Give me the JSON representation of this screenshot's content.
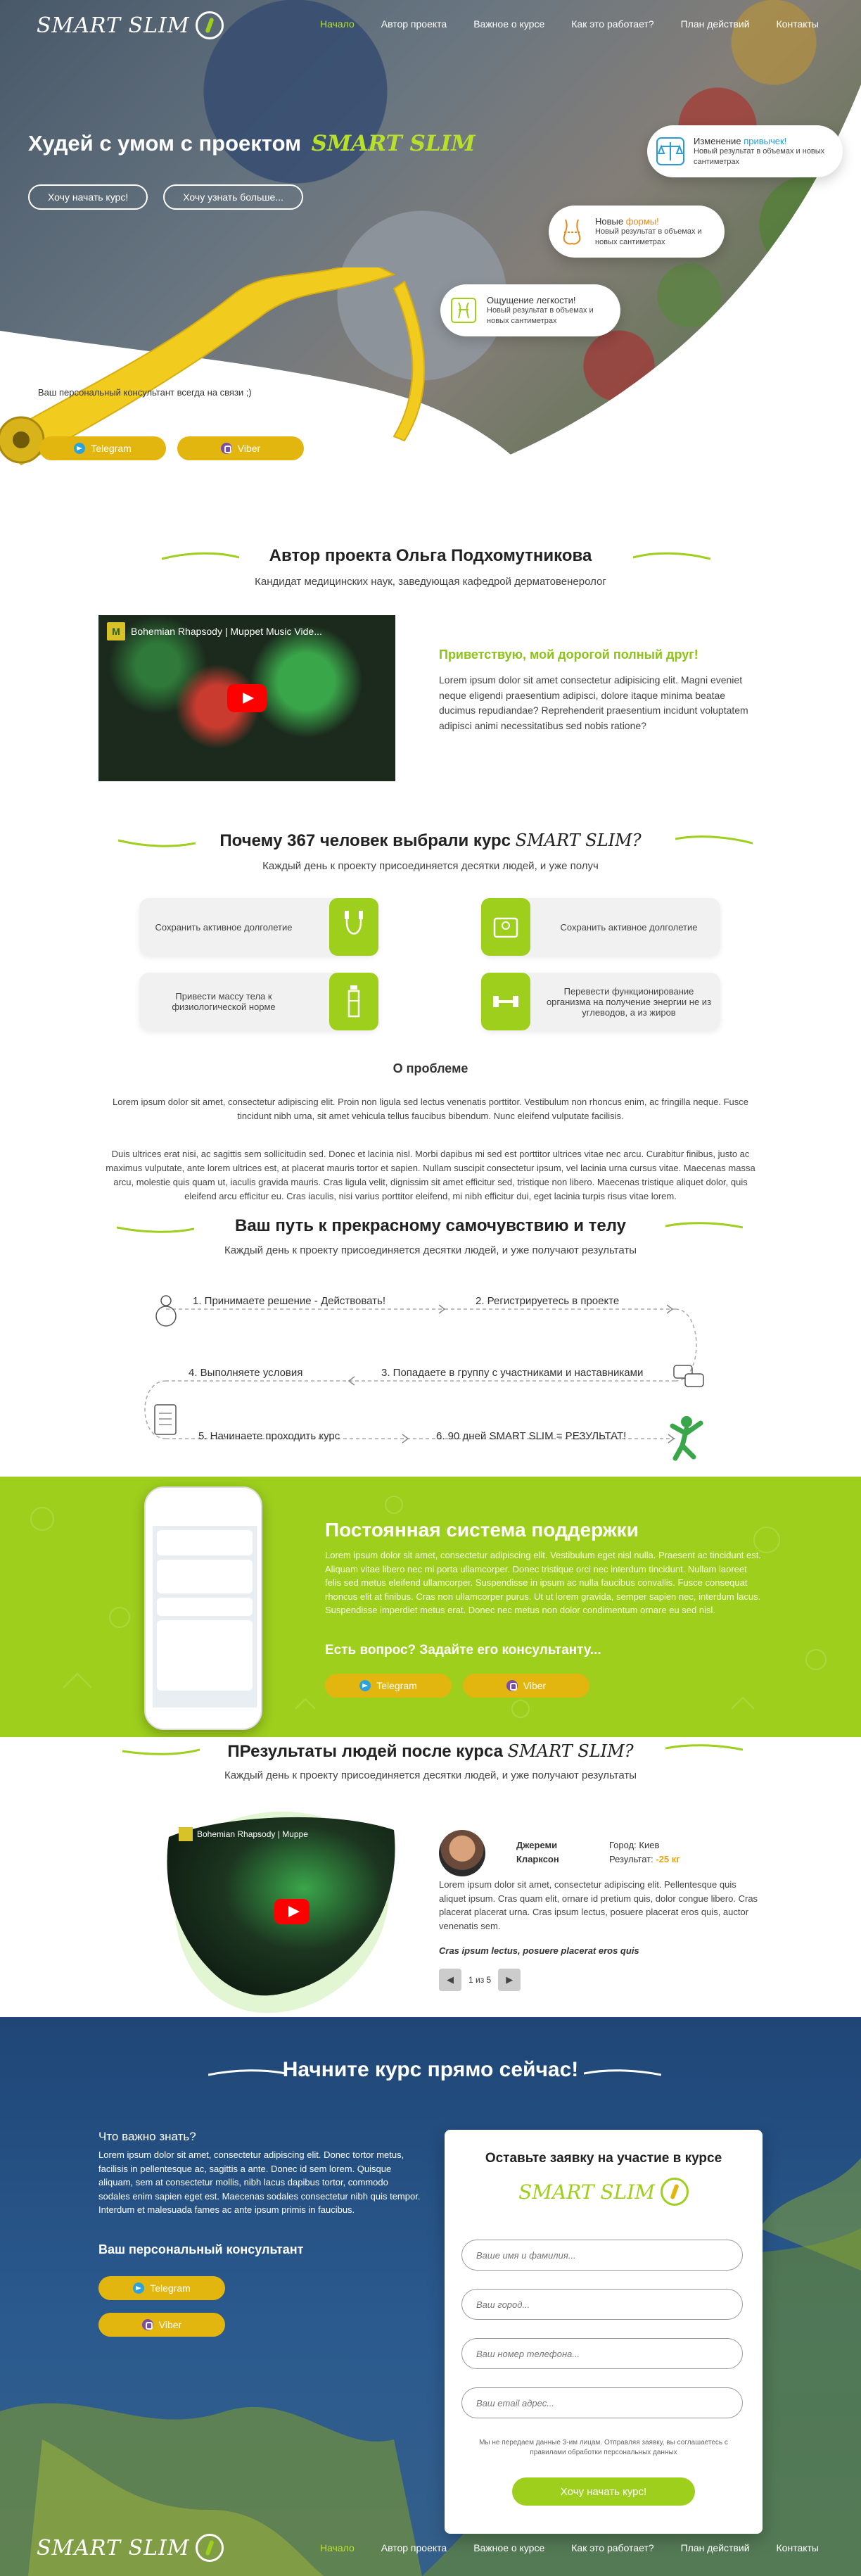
{
  "brand": "SMART SLIM",
  "nav": {
    "items": [
      {
        "label": "Начало",
        "active": true
      },
      {
        "label": "Автор проекта",
        "active": false
      },
      {
        "label": "Важное о курсе",
        "active": false
      },
      {
        "label": "Как это работает?",
        "active": false
      },
      {
        "label": "План действий",
        "active": false
      },
      {
        "label": "Контакты",
        "active": false
      }
    ]
  },
  "hero": {
    "title": "Худей с умом с проектом",
    "brand": "SMART SLIM",
    "btn_start": "Хочу начать курс!",
    "btn_more": "Хочу узнать больше...",
    "consultant_text": "Ваш персональный консультант всегда на связи ;)",
    "telegram": "Telegram",
    "viber": "Viber",
    "bubbles": [
      {
        "title_plain": "Изменение",
        "title_accent": "привычек!",
        "accent_color": "#2b9bd6",
        "text": "Новый результат в объемах и новых сантиметрах",
        "icon": "scales-icon",
        "icon_color": "#2b9bd6"
      },
      {
        "title_plain": "Новые",
        "title_accent": "формы!",
        "accent_color": "#e8891b",
        "text": "Новый результат в объемах и новых сантиметрах",
        "icon": "body-shape-icon",
        "icon_color": "#e8891b"
      },
      {
        "title_plain": "Ощущение легкости!",
        "title_accent": "",
        "accent_color": "#9ecf1d",
        "text": "Новый результат в объемах и новых сантиметрах",
        "icon": "feather-body-icon",
        "icon_color": "#9ecf1d"
      }
    ]
  },
  "author": {
    "title": "Автор проекта Ольга Подхомутникова",
    "subtitle": "Кандидат медицинских наук, заведующая кафедрой дерматовенеролог",
    "video_title": "Bohemian Rhapsody | Muppet Music Vide...",
    "greeting": "Приветствую, мой дорогой полный друг!",
    "text": "Lorem ipsum dolor sit amet consectetur adipisicing elit. Magni eveniet neque eligendi praesentium adipisci, dolore itaque minima beatae ducimus repudiandae? Reprehenderit praesentium incidunt voluptatem adipisci animi necessitatibus sed nobis ratione?"
  },
  "why": {
    "title": "Почему 367 человек выбрали курс",
    "brand": "SMART SLIM?",
    "subtitle": "Каждый день к проекту присоединяется десятки людей, и уже получ",
    "cards": [
      {
        "text": "Сохранить активное долголетие",
        "icon": "jump-rope-icon"
      },
      {
        "text": "Сохранить активное долголетие",
        "icon": "scale-icon"
      },
      {
        "text": "Привести массу тела к физиологической норме",
        "icon": "water-bottle-icon"
      },
      {
        "text": "Перевести функционирование организма на получение энергии не из углеводов, а из жиров",
        "icon": "dumbbell-icon"
      }
    ]
  },
  "problem": {
    "title": "О проблеме",
    "p1": "Lorem ipsum dolor sit amet, consectetur adipiscing elit. Proin non ligula sed lectus venenatis porttitor. Vestibulum non rhoncus enim, ac fringilla neque. Fusce tincidunt nibh urna, sit amet vehicula tellus faucibus bibendum. Nunc eleifend vulputate facilisis.",
    "p2": "Duis ultrices erat nisi, ac sagittis sem sollicitudin sed. Donec et lacinia nisl. Morbi dapibus mi sed est porttitor ultrices vitae nec arcu. Curabitur finibus, justo ac maximus vulputate, ante lorem ultrices est, at placerat mauris tortor et sapien. Nullam suscipit consectetur ipsum, vel lacinia urna cursus vitae. Maecenas massa arcu, molestie quis quam ut, iaculis gravida mauris. Cras ligula velit, dignissim sit amet efficitur sed, tristique non libero. Maecenas tristique aliquet dolor, quis eleifend arcu efficitur eu. Cras iaculis, nisi varius porttitor eleifend, mi nibh efficitur dui, eget lacinia turpis risus vitae lorem."
  },
  "path": {
    "title": "Ваш путь к прекрасному самочувствию и телу",
    "subtitle": "Каждый день к проекту присоединяется десятки людей, и уже получают результаты",
    "steps": [
      "1. Принимаете решение - Действовать!",
      "2. Регистрируетесь в проекте",
      "3. Попадаете в группу с участниками и наставниками",
      "4. Выполняете условия",
      "5. Начинаете проходить курс",
      "6. 90 дней SMART SLIM = РЕЗУЛЬТАТ!"
    ]
  },
  "support": {
    "title": "Постоянная система поддержки",
    "text": "Lorem ipsum dolor sit amet, consectetur adipiscing elit. Vestibulum eget nisl nulla. Praesent ac tincidunt est. Aliquam vitae libero nec mi porta ullamcorper. Donec tristique orci nec interdum tincidunt. Nullam laoreet felis sed metus eleifend ullamcorper. Suspendisse in ipsum ac nulla faucibus convallis. Fusce consequat rhoncus elit at finibus. Cras non ullamcorper purus. Ut ut lorem gravida, semper sapien nec, interdum lacus. Suspendisse imperdiet metus erat. Donec nec metus non dolor condimentum ornare eu sed nisl.",
    "question": "Есть вопрос? Задайте его консультанту...",
    "telegram": "Telegram",
    "viber": "Viber"
  },
  "results": {
    "title": "ПРезультаты людей после курса",
    "brand": "SMART SLIM?",
    "subtitle": "Каждый день к проекту присоединяется десятки людей, и уже получают результаты",
    "reviewer_name": "Джереми Кларксон",
    "city": "Город: Киев",
    "result_label": "Результат:",
    "result_value": "-25 кг",
    "text": "Lorem ipsum dolor sit amet, consectetur adipiscing elit. Pellentesque quis aliquet ipsum. Cras quam elit, ornare id pretium quis, dolor congue libero. Cras placerat placerat urna. Cras ipsum lectus, posuere placerat eros quis, auctor venenatis sem.",
    "quote": "Cras ipsum lectus, posuere placerat eros quis",
    "pager": "1 из 5"
  },
  "cta": {
    "title": "Начните курс прямо сейчас!",
    "important_title": "Что важно знать?",
    "important_text": "Lorem ipsum dolor sit amet, consectetur adipiscing elit. Donec tortor metus, facilisis in pellentesque ac, sagittis a ante. Donec id sem lorem. Quisque aliquam, sem at consectetur mollis, nibh lacus dapibus tortor, commodo sodales enim sapien eget est. Maecenas sodales consectetur nibh quis tempor. Interdum et malesuada fames ac ante ipsum primis in faucibus.",
    "consultant": "Ваш персональный консультант",
    "telegram": "Telegram",
    "viber": "Viber",
    "form": {
      "title": "Оставьте заявку на участие в курсе",
      "name_ph": "Ваше имя и фамилия...",
      "city_ph": "Ваш город...",
      "phone_ph": "Ваш номер телефона...",
      "email_ph": "Ваш email адрес...",
      "note": "Мы не передаем данные 3-им лицам. Отправляя заявку, вы соглашаетесь с правилами обработки персональных данных",
      "submit": "Хочу начать курс!"
    }
  },
  "colors": {
    "accent_green": "#9ecf1d",
    "accent_yellow": "#e3b50f",
    "footer_blue": "#1f4676"
  }
}
